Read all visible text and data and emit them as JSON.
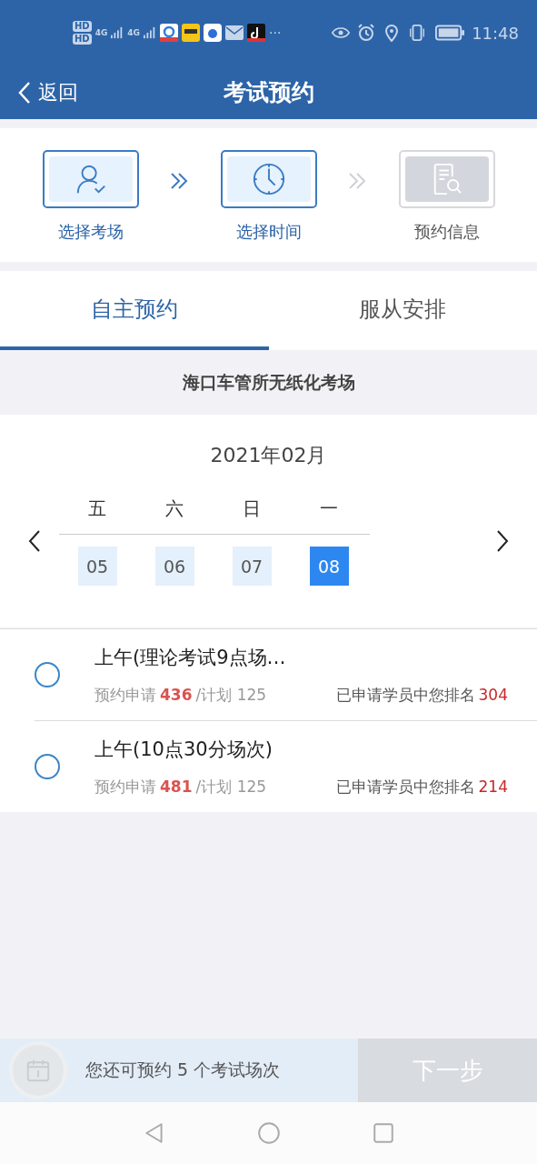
{
  "status_bar": {
    "sim_labels": [
      "HD",
      "HD"
    ],
    "network_labels": [
      "4G",
      "4G"
    ],
    "more": "···",
    "time": "11:48"
  },
  "header": {
    "back": "返回",
    "title": "考试预约"
  },
  "steps": [
    {
      "label": "选择考场",
      "active": true,
      "kind": "person"
    },
    {
      "label": "选择时间",
      "active": true,
      "kind": "clock"
    },
    {
      "label": "预约信息",
      "active": false,
      "kind": "document"
    }
  ],
  "tabs": [
    {
      "label": "自主预约",
      "selected": true
    },
    {
      "label": "服从安排",
      "selected": false
    }
  ],
  "venue": "海口车管所无纸化考场",
  "calendar": {
    "month": "2021年02月",
    "days": [
      {
        "weekday": "五",
        "date": "05",
        "selected": false
      },
      {
        "weekday": "六",
        "date": "06",
        "selected": false
      },
      {
        "weekday": "日",
        "date": "07",
        "selected": false
      },
      {
        "weekday": "一",
        "date": "08",
        "selected": true
      }
    ]
  },
  "slots": [
    {
      "title": "上午(理论考试9点场…",
      "applied_label": "预约申请",
      "applied": "436",
      "plan": "/计划 125",
      "rank_label": "已申请学员中您排名",
      "rank": "304",
      "selected": false
    },
    {
      "title": "上午(10点30分场次)",
      "applied_label": "预约申请",
      "applied": "481",
      "plan": "/计划 125",
      "rank_label": "已申请学员中您排名",
      "rank": "214",
      "selected": false
    }
  ],
  "footer": {
    "remaining": "您还可预约 5 个考试场次",
    "next": "下一步",
    "next_disabled": true
  }
}
